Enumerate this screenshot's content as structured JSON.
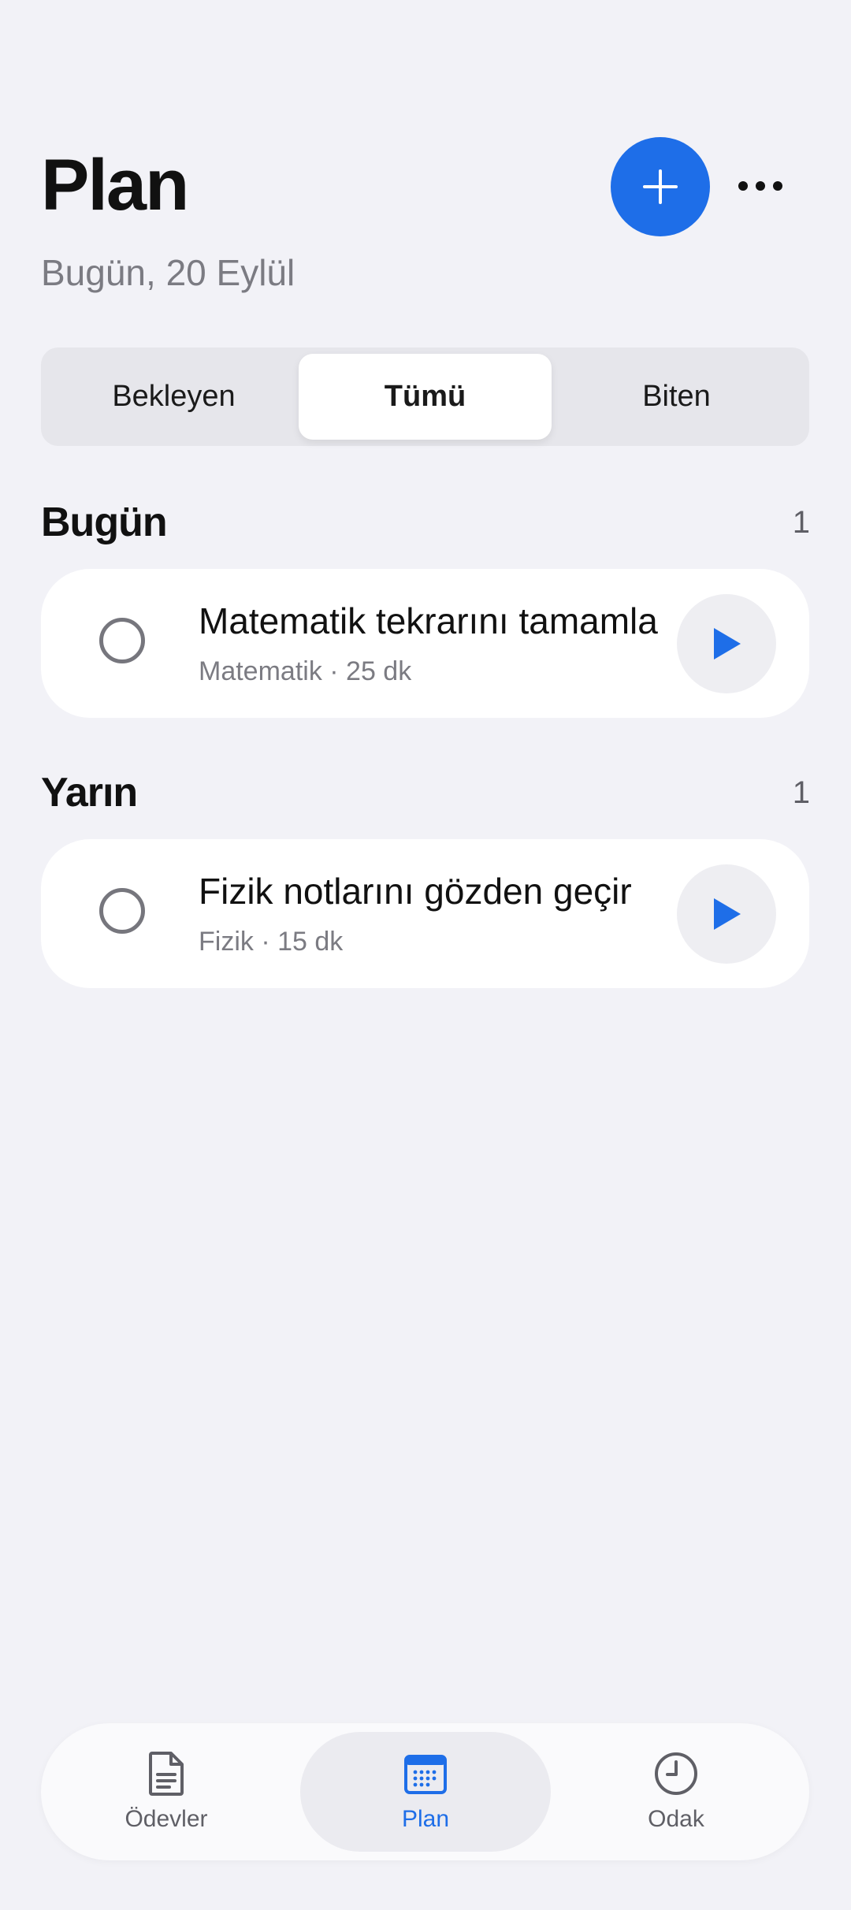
{
  "header": {
    "title": "Plan",
    "subtitle": "Bugün, 20 Eylül",
    "add_icon": "plus-icon",
    "more_icon": "ellipsis-icon"
  },
  "segments": [
    {
      "label": "Bekleyen",
      "active": false
    },
    {
      "label": "Tümü",
      "active": true
    },
    {
      "label": "Biten",
      "active": false
    }
  ],
  "sections": [
    {
      "title": "Bugün",
      "count": "1",
      "tasks": [
        {
          "title": "Matematik tekrarını tamamla",
          "meta": "Matematik · 25 dk",
          "done": false
        }
      ]
    },
    {
      "title": "Yarın",
      "count": "1",
      "tasks": [
        {
          "title": "Fizik notlarını gözden geçir",
          "meta": "Fizik · 15 dk",
          "done": false
        }
      ]
    }
  ],
  "tabbar": {
    "items": [
      {
        "label": "Ödevler",
        "icon": "document-icon",
        "active": false
      },
      {
        "label": "Plan",
        "icon": "calendar-icon",
        "active": true
      },
      {
        "label": "Odak",
        "icon": "clock-icon",
        "active": false
      }
    ]
  },
  "colors": {
    "accent": "#1E6EE8",
    "background": "#F2F2F7",
    "card": "#FFFFFF",
    "secondary_text": "#7B7B82"
  }
}
